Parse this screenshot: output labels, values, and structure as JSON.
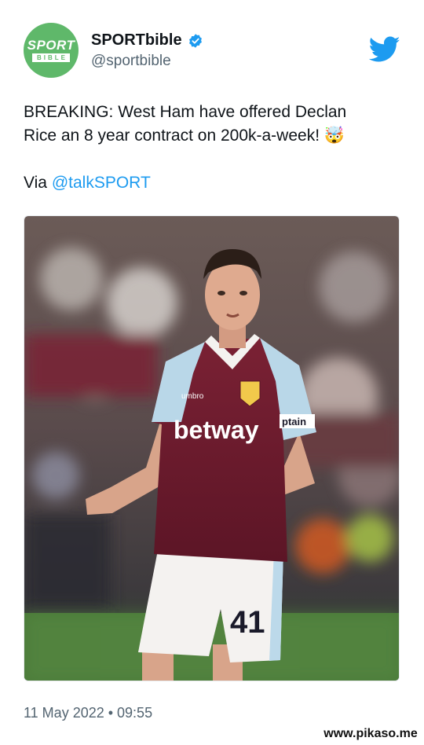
{
  "account": {
    "avatar_line1": "SPORT",
    "avatar_line2": "BIBLE",
    "display_name": "SPORTbible",
    "handle": "@sportbible",
    "verified": true
  },
  "tweet": {
    "text_line1": "BREAKING: West Ham have offered Declan",
    "text_line2": "Rice an 8 year contract on 200k-a-week!",
    "emoji": "🤯",
    "via_prefix": "Via",
    "via_mention": "@talkSPORT",
    "timestamp": "11 May 2022 • 09:55"
  },
  "media": {
    "alt": "Declan Rice in a West Ham shirt",
    "shirt_sponsor": "betway",
    "shorts_number": "41",
    "kit_brand": "umbro",
    "armband_text": "ptain"
  },
  "icons": {
    "bird": "twitter-bird-icon",
    "verified": "verified-badge-icon"
  },
  "colors": {
    "avatar_bg": "#5fb86a",
    "link": "#1d9bf0",
    "twitter_blue": "#1d9bf0",
    "secondary_text": "#536471"
  },
  "watermark": "www.pikaso.me"
}
